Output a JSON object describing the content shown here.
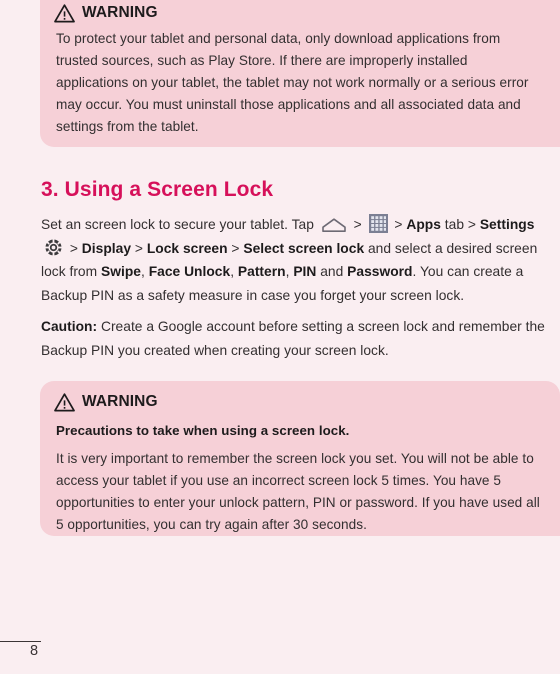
{
  "page": {
    "background_color": "#faeef1",
    "accent_color": "#d6105a",
    "callout_color": "#f6d0d7",
    "number": "8"
  },
  "warning_top": {
    "icon": "warning-triangle-icon",
    "title": "WARNING",
    "body": "To protect your tablet and personal data, only download applications from trusted sources, such as Play Store. If there are improperly installed applications on your tablet, the tablet may not work normally or a serious error may occur. You must uninstall those applications and all associated data and settings from the tablet."
  },
  "section": {
    "heading": "3. Using a Screen Lock",
    "paragraph1": {
      "part1": "Set an screen lock to secure your tablet. Tap ",
      "home_icon": "home-icon",
      "sep1": " > ",
      "apps_icon": "apps-grid-icon",
      "sep2": " > ",
      "apps_tab": "Apps",
      "part2": " tab > ",
      "settings": "Settings",
      "gear_icon": "settings-gear-icon",
      "sep3": " > ",
      "display": "Display",
      "sep4": " > ",
      "lock_screen": "Lock screen",
      "sep5": " > ",
      "select_screen_lock": "Select screen lock",
      "part3": " and select a desired screen lock from ",
      "swipe": "Swipe",
      "comma1": ", ",
      "face_unlock": "Face Unlock",
      "comma2": ", ",
      "pattern": "Pattern",
      "comma3": ", ",
      "pin": "PIN",
      "and": " and ",
      "password": "Password",
      "part4": ". You can create a Backup PIN as a safety measure in case you forget your screen lock."
    },
    "caution": {
      "label": "Caution:",
      "text": " Create a Google account before setting a screen lock and remember the Backup PIN you created when creating your screen lock."
    }
  },
  "warning_bottom": {
    "icon": "warning-triangle-icon",
    "title": "WARNING",
    "subtitle": "Precautions to take when using a screen lock.",
    "body": "It is very important to remember the screen lock you set. You will not be able to access your tablet if you use an incorrect screen lock 5 times. You have 5 opportunities to enter your unlock pattern, PIN or password. If you have used all 5 opportunities, you can try again after 30 seconds."
  }
}
